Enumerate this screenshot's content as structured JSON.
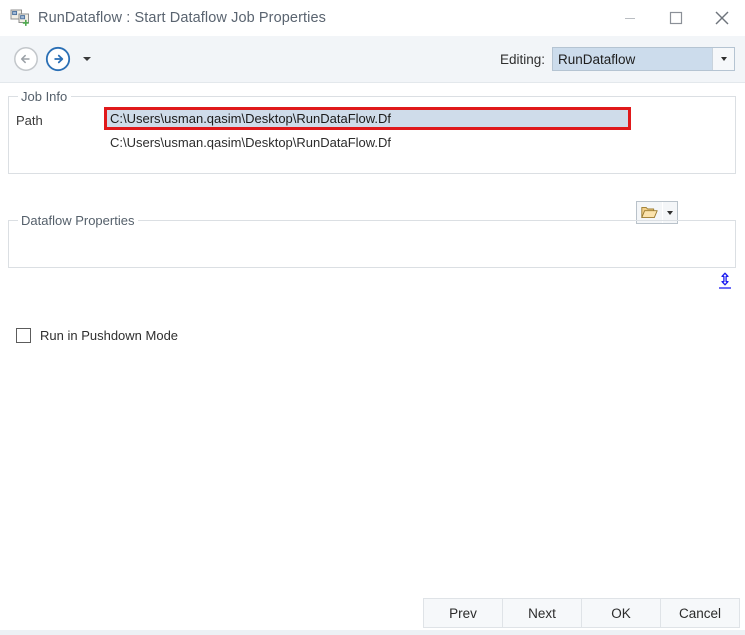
{
  "window": {
    "title": "RunDataflow : Start Dataflow Job Properties",
    "app_icon": "dataflow-job-icon",
    "controls": {
      "minimize": "minimize-icon",
      "maximize": "maximize-icon",
      "close": "close-icon"
    }
  },
  "navbar": {
    "back_label": "back-arrow-icon",
    "forward_label": "forward-arrow-icon",
    "history_caret": "chevron-down-icon",
    "editing_label": "Editing:",
    "editing_value": "RunDataflow",
    "editing_caret": "chevron-down-icon"
  },
  "job_info": {
    "legend": "Job Info",
    "path_label": "Path",
    "path_value": "C:\\Users\\usman.qasim\\Desktop\\RunDataFlow.Df",
    "path_suggestion": "C:\\Users\\usman.qasim\\Desktop\\RunDataFlow.Df",
    "browse_icon": "open-folder-icon",
    "browse_caret": "chevron-down-icon",
    "highlight_color": "#e0191b"
  },
  "splitter": {
    "icon": "vertical-resize-icon",
    "color": "#1c1cf0"
  },
  "dataflow_properties": {
    "legend": "Dataflow Properties",
    "pushdown_label": "Run in Pushdown Mode",
    "pushdown_checked": false
  },
  "footer": {
    "buttons": [
      {
        "label": "Prev"
      },
      {
        "label": "Next"
      },
      {
        "label": "OK"
      },
      {
        "label": "Cancel"
      }
    ]
  }
}
